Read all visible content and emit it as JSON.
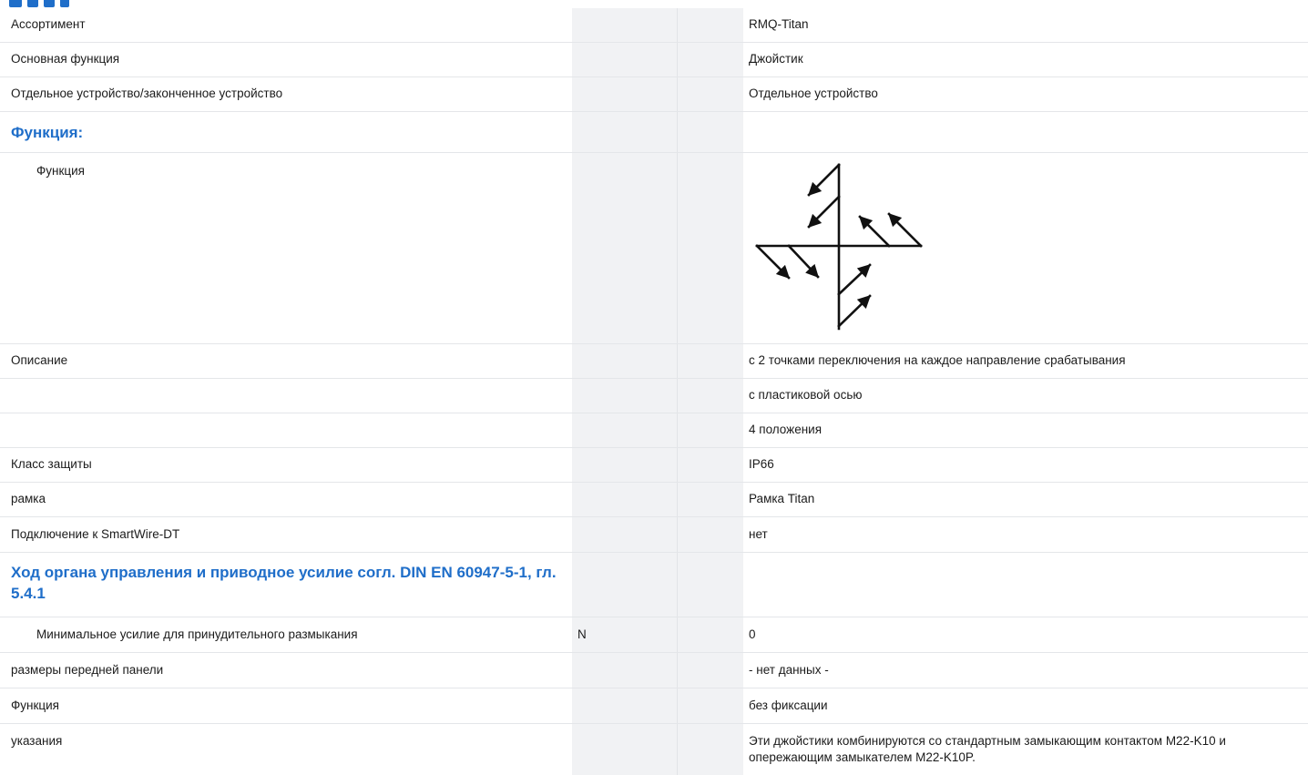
{
  "rows": [
    {
      "label": "Ассортимент",
      "unit": "",
      "value": "RMQ-Titan"
    },
    {
      "label": "Основная функция",
      "unit": "",
      "value": "Джойстик"
    },
    {
      "label": "Отдельное устройство/законченное устройство",
      "unit": "",
      "value": "Отдельное устройство"
    },
    {
      "section": "Функция:"
    },
    {
      "label": "Функция",
      "unit": "",
      "value": "",
      "icon": "joystick-switching-function-diagram"
    },
    {
      "label": "Описание",
      "unit": "",
      "value": "с 2 точками переключения на каждое направление срабатывания"
    },
    {
      "label": "",
      "unit": "",
      "value": "с пластиковой осью"
    },
    {
      "label": "",
      "unit": "",
      "value": "4 положения"
    },
    {
      "label": "Класс защиты",
      "unit": "",
      "value": "IP66"
    },
    {
      "label": "рамка",
      "unit": "",
      "value": "Рамка Titan"
    },
    {
      "label": "Подключение к SmartWire-DT",
      "unit": "",
      "value": "нет"
    },
    {
      "section": "Ход органа управления и приводное усилие согл. DIN EN 60947-5-1, гл. 5.4.1"
    },
    {
      "label": "Минимальное усилие для принудительного размыкания",
      "unit": "N",
      "value": "0"
    },
    {
      "label": "размеры передней панели",
      "unit": "",
      "value": "- нет данных -"
    },
    {
      "label": "Функция",
      "unit": "",
      "value": "без фиксации"
    },
    {
      "label": "указания",
      "unit": "",
      "value": "Эти джойстики комбинируются со стандартным замыкающим контактом M22-K10 и опережающим замыкателем M22-K10P."
    }
  ],
  "colors": {
    "accent": "#1f6ec9",
    "shade": "#f1f2f4",
    "border": "#e4e6e9"
  }
}
